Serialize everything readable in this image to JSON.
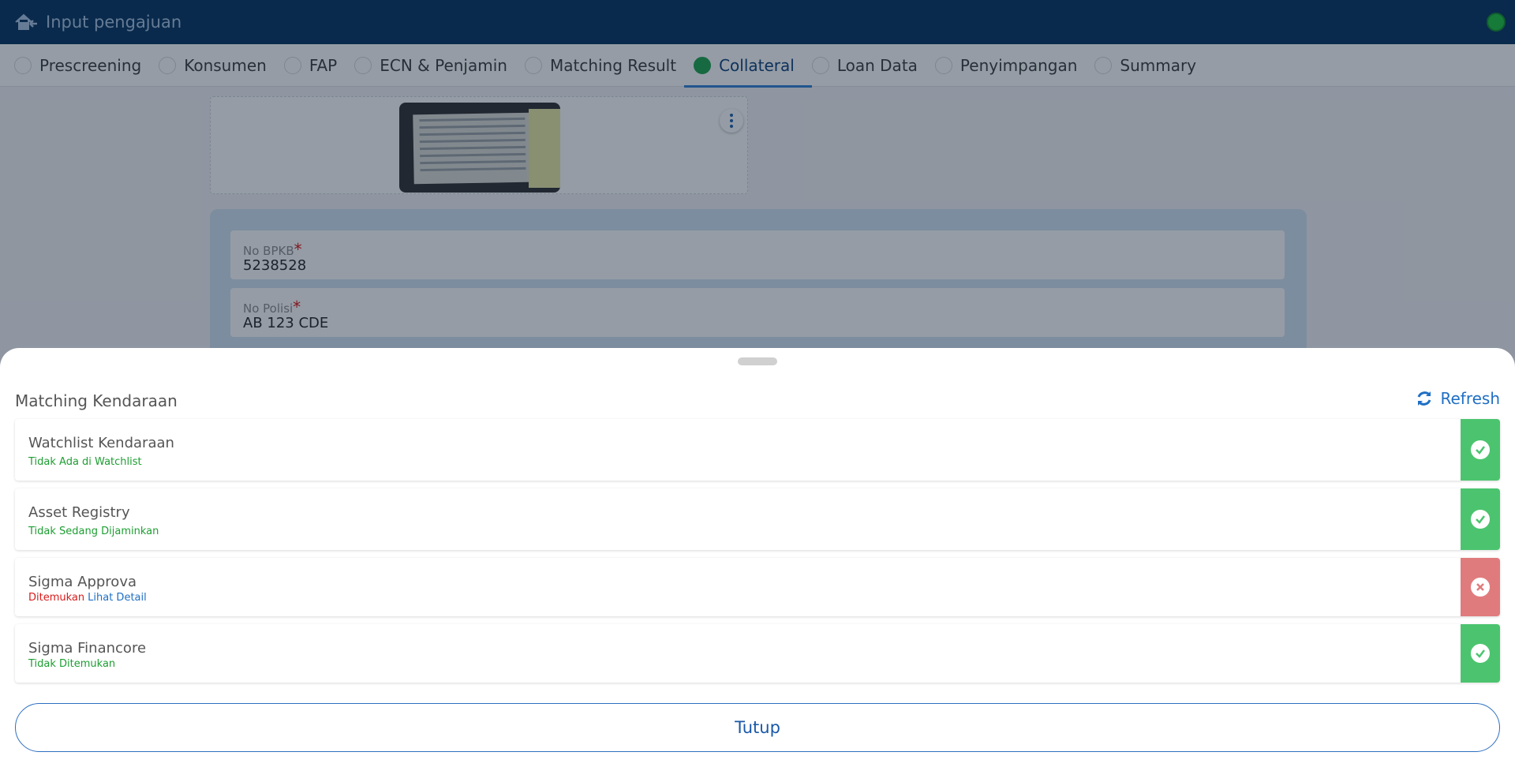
{
  "header": {
    "title": "Input pengajuan",
    "back_icon": "home-back-icon",
    "status_color": "#18c43a"
  },
  "tabs": [
    {
      "label": "Prescreening",
      "active": false
    },
    {
      "label": "Konsumen",
      "active": false
    },
    {
      "label": "FAP",
      "active": false
    },
    {
      "label": "ECN & Penjamin",
      "active": false
    },
    {
      "label": "Matching Result",
      "active": false
    },
    {
      "label": "Collateral",
      "active": true
    },
    {
      "label": "Loan Data",
      "active": false
    },
    {
      "label": "Penyimpangan",
      "active": false
    },
    {
      "label": "Summary",
      "active": false
    }
  ],
  "form": {
    "no_bpkb": {
      "label": "No BPKB",
      "required": "*",
      "value": "5238528"
    },
    "no_polisi": {
      "label": "No Polisi",
      "required": "*",
      "value": "AB 123 CDE"
    }
  },
  "sheet": {
    "title": "Matching Kendaraan",
    "refresh_label": "Refresh",
    "items": [
      {
        "name": "Watchlist Kendaraan",
        "status_text": "Tidak Ada di Watchlist",
        "result": "ok"
      },
      {
        "name": "Asset Registry",
        "status_text": "Tidak Sedang Dijaminkan",
        "result": "ok"
      },
      {
        "name": "Sigma Approva",
        "status_text": "Ditemukan",
        "link": "Lihat Detail",
        "result": "fail"
      },
      {
        "name": "Sigma Financore",
        "status_text": "Tidak Ditemukan",
        "result": "ok"
      }
    ],
    "close_label": "Tutup"
  },
  "colors": {
    "primary": "#00305e",
    "success": "#4cc46f",
    "danger": "#e07b7d",
    "link": "#1f6fc4"
  }
}
